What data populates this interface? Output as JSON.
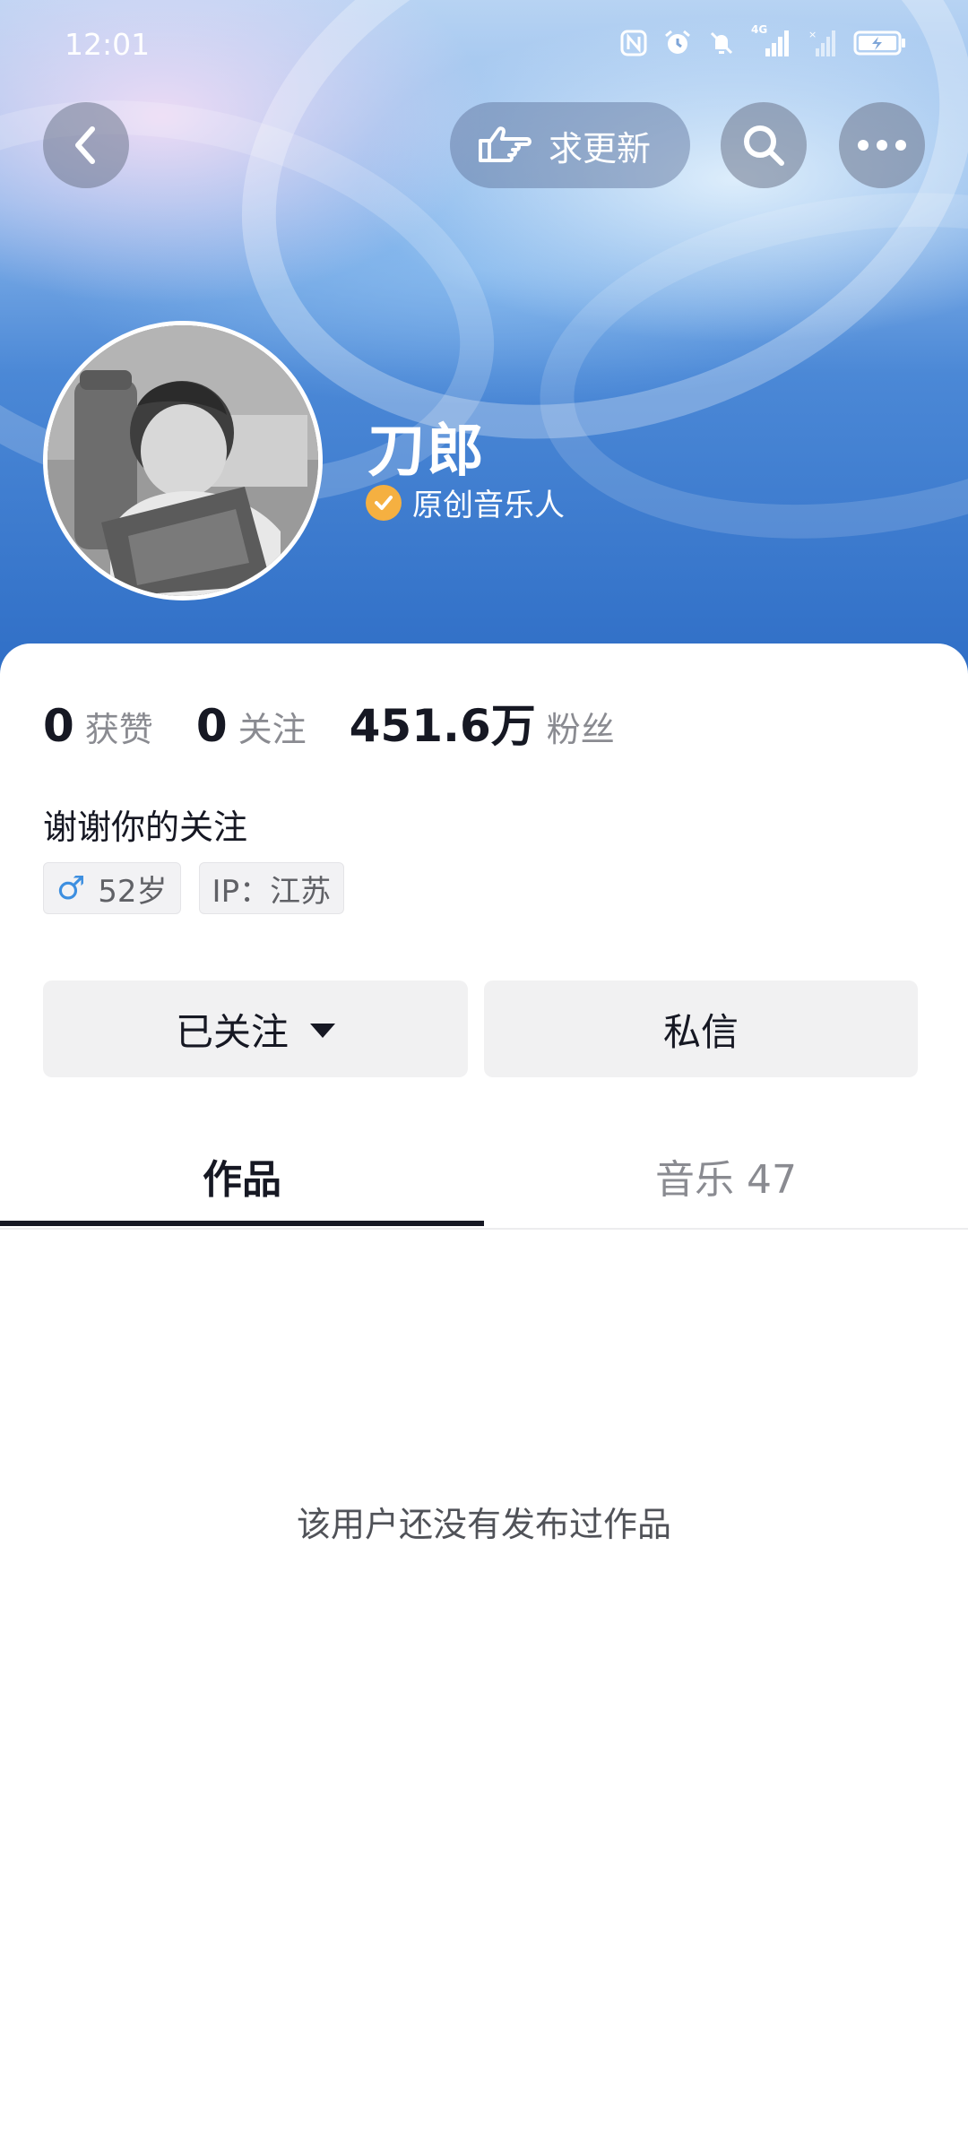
{
  "status_bar": {
    "time": "12:01",
    "icons": [
      "nfc-icon",
      "alarm-icon",
      "mute-icon",
      "signal-4g-icon",
      "signal-icon",
      "battery-charging-icon"
    ],
    "network_label": "4G"
  },
  "header": {
    "back_icon": "chevron-left-icon",
    "request_update_label": "求更新",
    "search_icon": "search-icon",
    "more_icon": "more-horizontal-icon"
  },
  "profile": {
    "name": "刀郎",
    "verification": "原创音乐人",
    "verify_badge_color": "#f5b041"
  },
  "stats": [
    {
      "value": "0",
      "label": "获赞"
    },
    {
      "value": "0",
      "label": "关注"
    },
    {
      "value": "451.6万",
      "label": "粉丝"
    }
  ],
  "bio": "谢谢你的关注",
  "tags": {
    "gender_symbol": "♂",
    "age": "52岁",
    "ip": "IP：江苏"
  },
  "actions": {
    "followed_label": "已关注",
    "message_label": "私信"
  },
  "tabs": [
    {
      "label": "作品",
      "active": true
    },
    {
      "label": "音乐 47",
      "active": false
    }
  ],
  "empty_state": "该用户还没有发布过作品",
  "colors": {
    "header_gradient_bottom": "#2f6ec6",
    "text_primary": "#161823",
    "text_secondary": "#8a8b91",
    "button_bg": "#f1f1f2"
  }
}
